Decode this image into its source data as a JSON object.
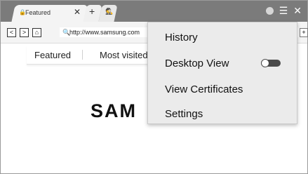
{
  "tab": {
    "title": "Featured",
    "close": "✕",
    "lock": "🔒"
  },
  "new_tab": "+",
  "secret_tab_icon": "🕵",
  "window_icons": {
    "menu": "☰",
    "close": "✕"
  },
  "nav": {
    "back": "<",
    "forward": ">",
    "home": "⌂"
  },
  "address": {
    "icon": "🔍",
    "url": "http://www.samsung.com",
    "add": "+"
  },
  "quick_tabs": [
    "Featured",
    "Most visited"
  ],
  "logo_text": "SAM",
  "menu": {
    "items": [
      "History",
      "Desktop View",
      "View Certificates",
      "Settings"
    ],
    "desktop_view_toggle": "off"
  },
  "colors": {
    "tabbar": "#7b7b7b",
    "menu_bg": "#ebebeb",
    "toggle": "#4a4a4a"
  }
}
